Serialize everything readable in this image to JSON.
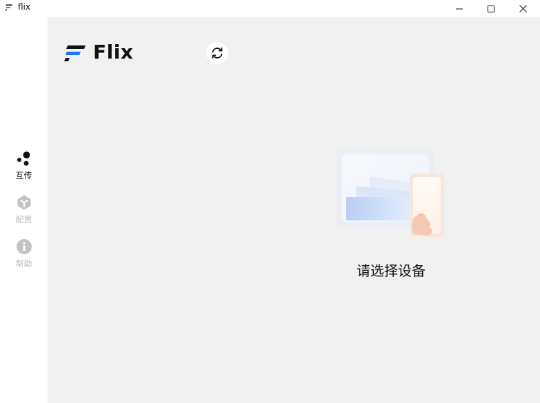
{
  "window": {
    "title": "flix",
    "controls": {
      "minimize": "minimize-icon",
      "maximize": "maximize-icon",
      "close": "close-icon"
    }
  },
  "sidebar": {
    "items": [
      {
        "label": "互传",
        "icon": "share-dots-icon",
        "active": true
      },
      {
        "label": "配置",
        "icon": "cube-icon",
        "active": false
      },
      {
        "label": "帮助",
        "icon": "info-icon",
        "active": false
      }
    ]
  },
  "header": {
    "brand": "Flix",
    "refresh_icon": "refresh-icon"
  },
  "main": {
    "empty_message": "请选择设备",
    "empty_illustration": "devices-illustration"
  },
  "colors": {
    "brand_blue": "#1677ff",
    "background": "#f1f1f1",
    "sidebar": "#ffffff",
    "inactive": "#bdbdbd"
  }
}
